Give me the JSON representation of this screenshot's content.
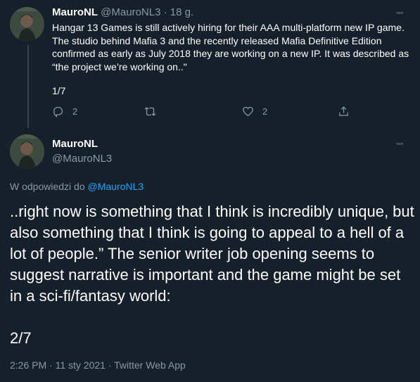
{
  "tweet1": {
    "author_name": "MauroNL",
    "author_handle": "@MauroNL3",
    "separator": "·",
    "time_ago": "18 g.",
    "more_label": "◦◦◦",
    "text": "Hangar 13 Games is still actively hiring for their AAA multi-platform new IP game. The studio behind Mafia 3 and the recently released Mafia Definitive Edition confirmed as early as July 2018 they are working on a new IP. It was described as “the project we’re working on..\"",
    "thread_count": "1/7",
    "actions": {
      "reply_count": "2",
      "retweet_count": "",
      "like_count": "2"
    }
  },
  "tweet2": {
    "author_name": "MauroNL",
    "author_handle": "@MauroNL3",
    "more_label": "◦◦◦",
    "reply_prefix": "W odpowiedzi do",
    "reply_to": "@MauroNL3",
    "text": "..right now is something that I think is incredibly unique, but also something that I think is going to appeal to a hell of a lot of people.” The senior writer job opening seems to suggest narrative is important and the game might be set in a sci-fi/fantasy world:",
    "thread_count": "2/7",
    "timestamp": "2:26 PM · 11 sty 2021 · Twitter Web App"
  },
  "colors": {
    "background": "#15202b",
    "text": "#ffffff",
    "muted": "#8899a6",
    "link": "#1da1f2",
    "divider": "#38444d"
  },
  "icons": [
    "avatar",
    "reply-icon",
    "retweet-icon",
    "like-icon",
    "share-icon",
    "more-icon"
  ]
}
